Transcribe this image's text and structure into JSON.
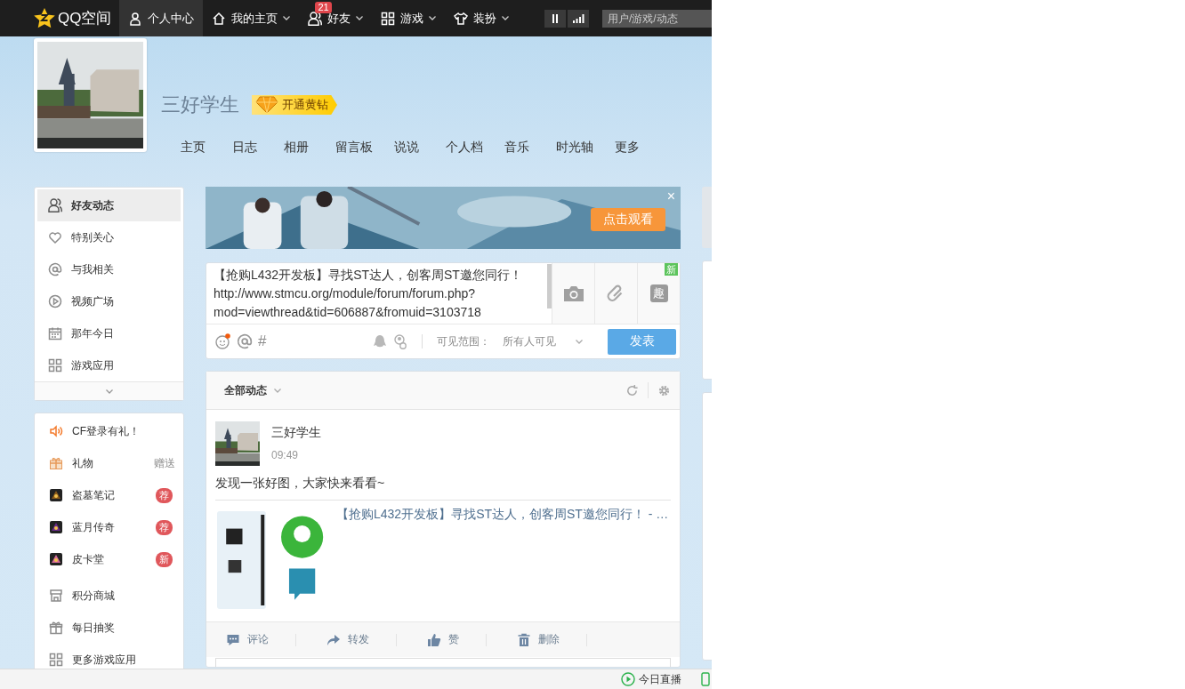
{
  "topbar": {
    "logo": "QQ空间",
    "items": [
      {
        "label": "个人中心",
        "kind": "person",
        "selected": true,
        "dropdown": false
      },
      {
        "label": "我的主页",
        "kind": "home",
        "selected": false,
        "dropdown": true
      },
      {
        "label": "好友",
        "kind": "friends",
        "selected": false,
        "dropdown": true,
        "badge": "21"
      },
      {
        "label": "游戏",
        "kind": "grid",
        "selected": false,
        "dropdown": true
      },
      {
        "label": "装扮",
        "kind": "shirt",
        "selected": false,
        "dropdown": true
      }
    ],
    "search": {
      "placeholder": "用户/游戏/动态"
    }
  },
  "profile": {
    "name": "三好学生",
    "vip_badge": "开通黄钻",
    "nav": [
      "主页",
      "日志",
      "相册",
      "留言板",
      "说说",
      "个人档",
      "音乐",
      "时光轴",
      "更多"
    ]
  },
  "sidebar": {
    "items": [
      {
        "label": "好友动态",
        "kind": "friends",
        "selected": true
      },
      {
        "label": "特别关心",
        "kind": "heart",
        "selected": false
      },
      {
        "label": "与我相关",
        "kind": "at",
        "selected": false
      },
      {
        "label": "视频广场",
        "kind": "play",
        "selected": false
      },
      {
        "label": "那年今日",
        "kind": "calendar",
        "selected": false
      },
      {
        "label": "游戏应用",
        "kind": "grid",
        "selected": false
      }
    ]
  },
  "apps": {
    "items": [
      {
        "label": "CF登录有礼！",
        "kind": "speaker"
      },
      {
        "label": "礼物",
        "kind": "gift-box",
        "note": "赠送"
      },
      {
        "label": "盗墓笔记",
        "kind": "game",
        "badge": "荐"
      },
      {
        "label": "蓝月传奇",
        "kind": "game",
        "badge": "荐"
      },
      {
        "label": "皮卡堂",
        "kind": "game",
        "badge": "新"
      }
    ],
    "more_items": [
      {
        "label": "积分商城",
        "kind": "shop"
      },
      {
        "label": "每日抽奖",
        "kind": "gift"
      },
      {
        "label": "更多游戏应用",
        "kind": "grid"
      }
    ]
  },
  "banner": {
    "kind": "picture",
    "button": "点击观看",
    "close": "×"
  },
  "composer": {
    "text": "【抢购L432开发板】寻找ST达人，创客周ST邀您同行！\nhttp://www.stmcu.org/module/forum/forum.php?\nmod=viewthread&tid=606887&fromuid=3103718",
    "new_tag": "新",
    "qu_label": "趣",
    "topic": "#",
    "visibility_label": "可见范围：",
    "visibility": "所有人可见",
    "submit": "发表"
  },
  "feed": {
    "filter": "全部动态",
    "post": {
      "author": "三好学生",
      "time": "09:49",
      "text": "发现一张好图，大家快来看看~",
      "link_title": "【抢购L432开发板】寻找ST达人，创客周ST邀您同行！ - …",
      "actions": [
        {
          "label": "评论",
          "kind": "comment"
        },
        {
          "label": "转发",
          "kind": "share"
        },
        {
          "label": "赞",
          "kind": "like"
        },
        {
          "label": "删除",
          "kind": "trash"
        }
      ]
    }
  },
  "status_bar": {
    "live": "今日直播"
  }
}
